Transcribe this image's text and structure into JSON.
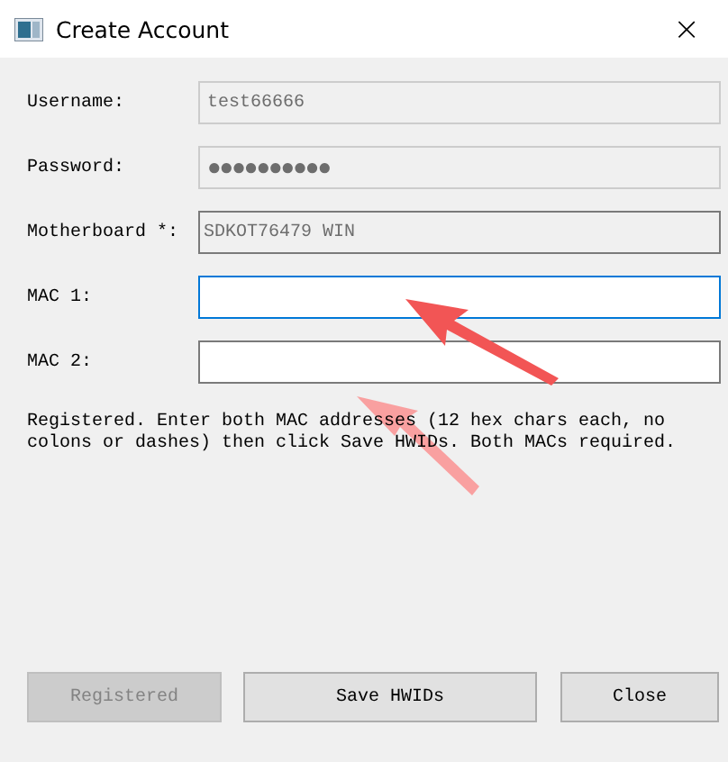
{
  "window": {
    "title": "Create Account",
    "close": "×"
  },
  "fields": [
    {
      "label": "Username:",
      "value": "test66666",
      "disabled": true,
      "focused": false
    },
    {
      "label": "Password:",
      "value": "●●●●●●●●●●",
      "disabled": true,
      "focused": false
    },
    {
      "label": "Motherboard *:",
      "value": "SDKOT76479 WIN",
      "disabled": false,
      "readonly": true,
      "focused": false
    },
    {
      "label": "MAC 1:",
      "disabled": false,
      "readonly": false,
      "focused": true
    },
    {
      "label": "MAC 2:",
      "disabled": false,
      "readonly": false,
      "focused": false
    }
  ],
  "message": "Registered. Enter both MAC addresses (12 hex chars each, no colons or dashes) then click Save HWIDs. Both MACs required.",
  "buttons": [
    {
      "label": "Registered",
      "disabled": true
    },
    {
      "label": "Save HWIDs",
      "disabled": false
    },
    {
      "label": "Close",
      "disabled": false
    }
  ]
}
